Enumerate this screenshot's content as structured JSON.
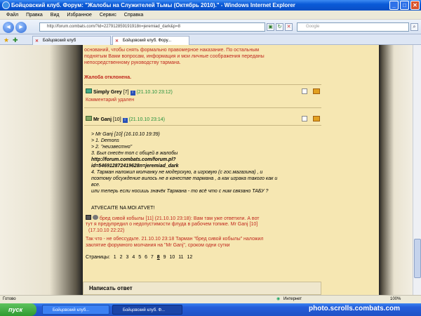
{
  "window": {
    "title": "Бойцовский клуб. Форум: \"Жалобы на Служителей Тьмы (Октябрь 2010).\" - Windows Internet Explorer",
    "minimize": "_",
    "maximize": "□",
    "close": "✕"
  },
  "menu": [
    "Файл",
    "Правка",
    "Вид",
    "Избранное",
    "Сервис",
    "Справка"
  ],
  "address": {
    "url": "http://forum.combats.com/?id=227912859191918n=jeremiad_dark&p=8",
    "search_placeholder": "Google"
  },
  "tabs": [
    {
      "label": "Бойцовский клуб"
    },
    {
      "label": "Бойцовский клуб. Фору..."
    }
  ],
  "page": {
    "intro_lines": [
      "оснований, чтобы снять формально правомерное наказание. По остальным",
      "поднятым Вами вопросам, информация и мои личные соображения переданы",
      "непосредственному руководству тармана."
    ],
    "complaint_rejected": "Жалоба отклонена.",
    "post1": {
      "author": "Simply Grey",
      "level": "[7]",
      "time": "(21.10.10 23:12)",
      "note": "Комментарий удален"
    },
    "post2": {
      "author": "Mr Ganj",
      "level": "[10]",
      "time": "(21.10.10 23:14)",
      "lines": [
        ">   Mr Ganj [10] (16.10.10 19:39)",
        "> 1. Demons",
        "> 2. \"неизвестно\"",
        "3. Был снесён топ с общей в жалобы",
        "http://forum.combats.com/forum.pl?",
        "id=546912872419628n=jeremiad_dark",
        "4. Тарман наложил молчанку не модерскую, а игровую (с гос.магазина) , и",
        "поэтому обсуждение вилось не в качестве тармана , а как играка такого как и",
        "все.",
        "или теперь если носишь значёк Тармана - то всё что с ним связано ТАБУ ?"
      ],
      "footer": "ATVECAITE NA MOI ATVET!"
    },
    "moderator": {
      "line1": "бред сивой кобылы [11]  (21.10.10 23:18): Вам там уже ответили. А вот",
      "line2": "тут я предупредил о недопустимости флуда в рабочем топике. Mr Ganj [10]",
      "line3": "(17.10.10 22:22)",
      "line4": "Так что - не обессудьте. 21.10.10 23:18   Тарман \"бред сивой кобылы\" наложил",
      "line5": "заклятие форумного молчания на \"Mr Ganj\", сроком одни сутки"
    },
    "pages_label": "Страницы:",
    "pages": [
      "1",
      "2",
      "3",
      "4",
      "5",
      "6",
      "7",
      "8",
      "9",
      "10",
      "11",
      "12"
    ],
    "current_page": "8",
    "reply_title": "Написать ответ"
  },
  "status": {
    "left": "Готово",
    "zone": "Интернет",
    "zoom": "100%"
  },
  "taskbar": {
    "start": "пуск",
    "items": [
      "Бойцовский клуб...",
      "Бойцовский клуб. Ф..."
    ],
    "watermark": "photo.scrolls.combats.com"
  }
}
